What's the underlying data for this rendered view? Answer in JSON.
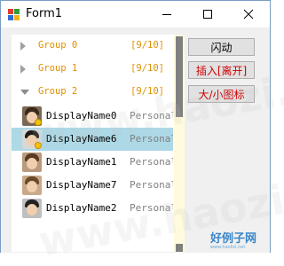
{
  "window": {
    "title": "Form1"
  },
  "list": {
    "groups": [
      {
        "name": "Group 0",
        "count": "[9/10]",
        "expanded": false
      },
      {
        "name": "Group 1",
        "count": "[9/10]",
        "expanded": false
      },
      {
        "name": "Group 2",
        "count": "[9/10]",
        "expanded": true
      }
    ],
    "items": [
      {
        "display_name": "DisplayName0",
        "personal_msg": "Personal M",
        "selected": false
      },
      {
        "display_name": "DisplayName6",
        "personal_msg": "Personal M",
        "selected": true
      },
      {
        "display_name": "DisplayName1",
        "personal_msg": "Personal M",
        "selected": false
      },
      {
        "display_name": "DisplayName7",
        "personal_msg": "Personal M",
        "selected": false
      },
      {
        "display_name": "DisplayName2",
        "personal_msg": "Personal M",
        "selected": false
      }
    ]
  },
  "buttons": {
    "flash": "闪动",
    "insert": "插入[离开]",
    "icon_size": "大/小图标"
  },
  "watermark": {
    "text": "www.haozi.com"
  },
  "corner_logo": {
    "main": "好例子网",
    "sub": "www.haolizi.net"
  },
  "colors": {
    "group_text": "#e09000",
    "selected_row": "#add8e6",
    "red_button_text": "#d00000",
    "scrollbar_track": "#fffbdc"
  }
}
